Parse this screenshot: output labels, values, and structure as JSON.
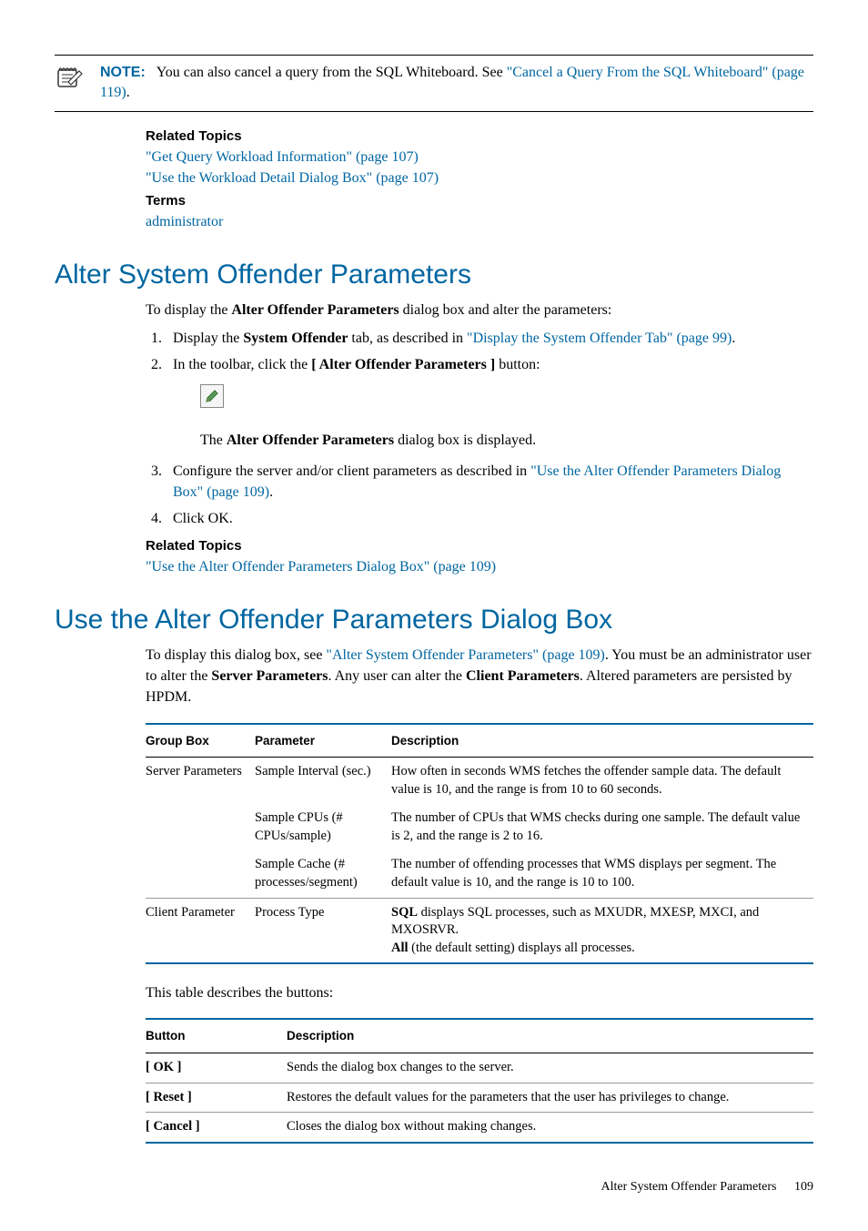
{
  "note": {
    "label": "NOTE:",
    "text_before_link": "You can also cancel a query from the SQL Whiteboard. See ",
    "link": "\"Cancel a Query From the SQL Whiteboard\" (page 119)",
    "text_after": "."
  },
  "related1": {
    "heading": "Related Topics",
    "link1": "\"Get Query Workload Information\" (page 107)",
    "link2": "\"Use the Workload Detail Dialog Box\" (page 107)",
    "terms_label": "Terms",
    "terms_link": "administrator"
  },
  "h1a": "Alter System Offender Parameters",
  "p1_before": "To display the ",
  "p1_bold": "Alter Offender Parameters",
  "p1_after": " dialog box and alter the parameters:",
  "ol1": {
    "li1_a": "Display the ",
    "li1_bold": "System Offender",
    "li1_b": " tab, as described in ",
    "li1_link": "\"Display the System Offender Tab\" (page 99)",
    "li1_c": ".",
    "li2_a": "In the toolbar, click the ",
    "li2_bold": "[ Alter Offender Parameters ]",
    "li2_b": " button:",
    "li2_sub_a": "The ",
    "li2_sub_bold": "Alter Offender Parameters",
    "li2_sub_b": " dialog box is displayed.",
    "li3_a": "Configure the server and/or client parameters as described in ",
    "li3_link": "\"Use the Alter Offender Parameters Dialog Box\" (page 109)",
    "li3_b": ".",
    "li4": "Click OK."
  },
  "related2": {
    "heading": "Related Topics",
    "link": "\"Use the Alter Offender Parameters Dialog Box\" (page 109)"
  },
  "h1b": "Use the Alter Offender Parameters Dialog Box",
  "p2_a": "To display this dialog box, see ",
  "p2_link": "\"Alter System Offender Parameters\" (page 109)",
  "p2_b": ". You must be an administrator user to alter the ",
  "p2_bold1": "Server Parameters",
  "p2_c": ". Any user can alter the ",
  "p2_bold2": "Client Parameters",
  "p2_d": ". Altered parameters are persisted by HPDM.",
  "table1": {
    "h1": "Group Box",
    "h2": "Parameter",
    "h3": "Description",
    "r1c1": "Server Parameters",
    "r1c2": "Sample Interval (sec.)",
    "r1c3": "How often in seconds WMS fetches the offender sample data. The default value is 10, and the range is from 10 to 60 seconds.",
    "r2c2": "Sample CPUs (# CPUs/sample)",
    "r2c3": "The number of CPUs that WMS checks during one sample. The default value is 2, and the range is 2 to 16.",
    "r3c2": "Sample Cache (# processes/segment)",
    "r3c3": "The number of offending processes that WMS displays per segment. The default value is 10, and the range is 10 to 100.",
    "r4c1": "Client Parameter",
    "r4c2": "Process Type",
    "r4c3_b1": "SQL",
    "r4c3_t1": " displays SQL processes, such as MXUDR, MXESP, MXCI, and MXOSRVR.",
    "r4c3_b2": "All",
    "r4c3_t2": " (the default setting) displays all processes."
  },
  "p3": "This table describes the buttons:",
  "table2": {
    "h1": "Button",
    "h2": "Description",
    "r1c1": "[ OK ]",
    "r1c2": "Sends the dialog box changes to the server.",
    "r2c1": "[ Reset ]",
    "r2c2": "Restores the default values for the parameters that the user has privileges to change.",
    "r3c1": "[ Cancel ]",
    "r3c2": "Closes the dialog box without making changes."
  },
  "footer": {
    "title": "Alter System Offender Parameters",
    "page": "109"
  }
}
